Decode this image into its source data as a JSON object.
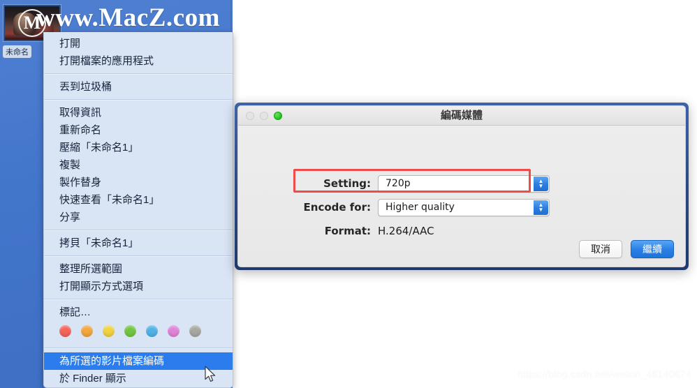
{
  "brand": {
    "site_text": "www.MacZ.com"
  },
  "desktop": {
    "file": {
      "label": "未命名",
      "icon_name": "video-thumbnail",
      "play_overlay": "M"
    }
  },
  "context_menu": {
    "groups": [
      {
        "items": [
          {
            "label": "打開",
            "submenu": false,
            "selected": false
          },
          {
            "label": "打開檔案的應用程式",
            "submenu": true,
            "selected": false
          }
        ]
      },
      {
        "items": [
          {
            "label": "丟到垃圾桶",
            "submenu": false,
            "selected": false
          }
        ]
      },
      {
        "items": [
          {
            "label": "取得資訊",
            "submenu": false,
            "selected": false
          },
          {
            "label": "重新命名",
            "submenu": false,
            "selected": false
          },
          {
            "label": "壓縮「未命名1」",
            "submenu": false,
            "selected": false
          },
          {
            "label": "複製",
            "submenu": false,
            "selected": false
          },
          {
            "label": "製作替身",
            "submenu": false,
            "selected": false
          },
          {
            "label": "快速查看「未命名1」",
            "submenu": false,
            "selected": false
          },
          {
            "label": "分享",
            "submenu": true,
            "selected": false
          }
        ]
      },
      {
        "items": [
          {
            "label": "拷貝「未命名1」",
            "submenu": false,
            "selected": false
          }
        ]
      },
      {
        "items": [
          {
            "label": "整理所選範圍",
            "submenu": false,
            "selected": false
          },
          {
            "label": "打開顯示方式選項",
            "submenu": false,
            "selected": false
          }
        ]
      },
      {
        "items": [
          {
            "label": "標記…",
            "submenu": false,
            "selected": false
          }
        ],
        "tags": [
          {
            "name": "tag-red",
            "color": "#f4645a"
          },
          {
            "name": "tag-orange",
            "color": "#f5a93c"
          },
          {
            "name": "tag-yellow",
            "color": "#f2d33c"
          },
          {
            "name": "tag-green",
            "color": "#6ec councils"
          }
        ]
      },
      {
        "items": [
          {
            "label": "為所選的影片檔案編碼",
            "submenu": false,
            "selected": true
          },
          {
            "label": "於 Finder 顯示",
            "submenu": false,
            "selected": false
          }
        ]
      }
    ],
    "tag_colors": [
      {
        "name": "tag-red",
        "color": "#f4645a"
      },
      {
        "name": "tag-orange",
        "color": "#f4a73c"
      },
      {
        "name": "tag-yellow",
        "color": "#f2d440"
      },
      {
        "name": "tag-green",
        "color": "#72c740"
      },
      {
        "name": "tag-blue",
        "color": "#4fb3e8"
      },
      {
        "name": "tag-purple",
        "color": "#e084d8"
      },
      {
        "name": "tag-gray",
        "color": "#a8a8a2"
      }
    ],
    "submenu_arrow_glyph": "►",
    "highlight_color": "#2b7cec"
  },
  "dialog": {
    "title": "編碼媒體",
    "traffic_lights": [
      {
        "name": "close-button",
        "state": "disabled"
      },
      {
        "name": "minimize-button",
        "state": "disabled"
      },
      {
        "name": "zoom-button",
        "state": "green"
      }
    ],
    "fields": [
      {
        "label": "Setting:",
        "value": "720p",
        "type": "popup",
        "highlighted": true
      },
      {
        "label": "Encode for:",
        "value": "Higher quality",
        "type": "popup",
        "highlighted": false
      },
      {
        "label": "Format:",
        "value": "H.264/AAC",
        "type": "static",
        "highlighted": false
      }
    ],
    "buttons": {
      "cancel": "取消",
      "continue": "繼續"
    },
    "highlight_color": "#ef4b4b"
  },
  "watermark": {
    "url": "https://blog.csdn.net/weixin_48140874"
  }
}
